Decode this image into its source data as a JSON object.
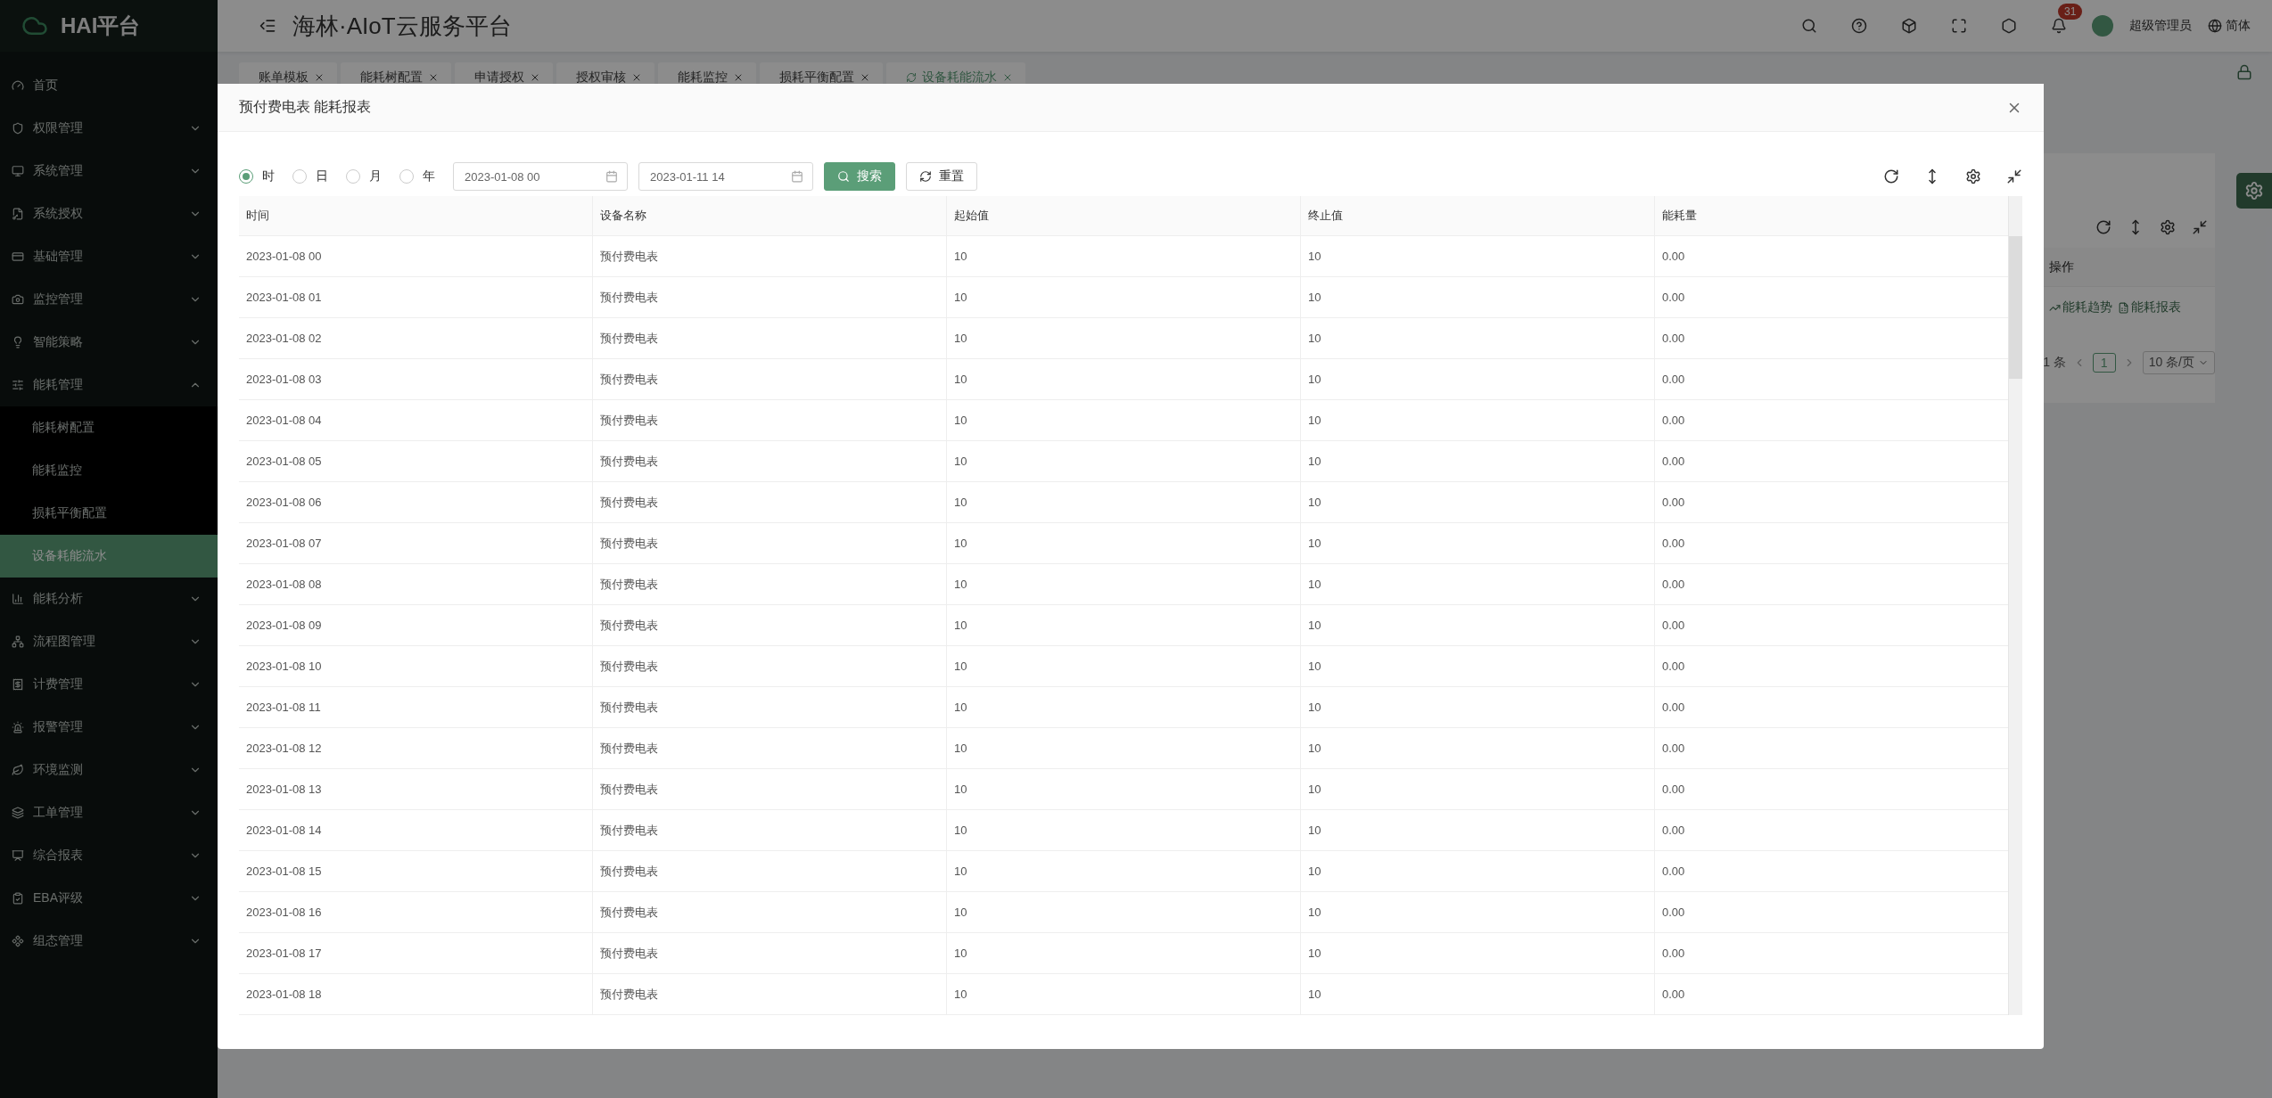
{
  "sidebar": {
    "logo": "HAI平台",
    "items": [
      {
        "label": "首页",
        "kind": "link"
      },
      {
        "label": "权限管理",
        "kind": "group",
        "expanded": false
      },
      {
        "label": "系统管理",
        "kind": "group",
        "expanded": false
      },
      {
        "label": "系统授权",
        "kind": "group",
        "expanded": false
      },
      {
        "label": "基础管理",
        "kind": "group",
        "expanded": false
      },
      {
        "label": "监控管理",
        "kind": "group",
        "expanded": false
      },
      {
        "label": "智能策略",
        "kind": "group",
        "expanded": false
      },
      {
        "label": "能耗管理",
        "kind": "group",
        "expanded": true,
        "children": [
          {
            "label": "能耗树配置",
            "selected": false
          },
          {
            "label": "能耗监控",
            "selected": false
          },
          {
            "label": "损耗平衡配置",
            "selected": false
          },
          {
            "label": "设备耗能流水",
            "selected": true
          }
        ]
      },
      {
        "label": "能耗分析",
        "kind": "group",
        "expanded": false
      },
      {
        "label": "流程图管理",
        "kind": "group",
        "expanded": false
      },
      {
        "label": "计费管理",
        "kind": "group",
        "expanded": false
      },
      {
        "label": "报警管理",
        "kind": "group",
        "expanded": false
      },
      {
        "label": "环境监测",
        "kind": "group",
        "expanded": false
      },
      {
        "label": "工单管理",
        "kind": "group",
        "expanded": false
      },
      {
        "label": "综合报表",
        "kind": "group",
        "expanded": false
      },
      {
        "label": "EBA评级",
        "kind": "group",
        "expanded": false
      },
      {
        "label": "组态管理",
        "kind": "group",
        "expanded": false
      }
    ]
  },
  "header": {
    "title": "海林·AIoT云服务平台",
    "notification_count": "31",
    "user": "超级管理员",
    "language": "简体"
  },
  "tabs": [
    {
      "label": "账单模板",
      "selected": false
    },
    {
      "label": "能耗树配置",
      "selected": false
    },
    {
      "label": "申请授权",
      "selected": false
    },
    {
      "label": "授权审核",
      "selected": false
    },
    {
      "label": "能耗监控",
      "selected": false
    },
    {
      "label": "损耗平衡配置",
      "selected": false
    },
    {
      "label": "设备耗能流水",
      "selected": true
    }
  ],
  "background_panel": {
    "column": "操作",
    "links": [
      "能耗趋势",
      "能耗报表"
    ],
    "total": "1 条",
    "page": "1",
    "page_size": "10 条/页"
  },
  "modal": {
    "title": "预付费电表 能耗报表",
    "granularity": [
      {
        "label": "时",
        "selected": true
      },
      {
        "label": "日",
        "selected": false
      },
      {
        "label": "月",
        "selected": false
      },
      {
        "label": "年",
        "selected": false
      }
    ],
    "date_from": "2023-01-08 00",
    "date_to": "2023-01-11 14",
    "search_button": "搜索",
    "reset_button": "重置",
    "table": {
      "columns": [
        "时间",
        "设备名称",
        "起始值",
        "终止值",
        "能耗量"
      ],
      "rows": [
        [
          "2023-01-08 00",
          "预付费电表",
          "10",
          "10",
          "0.00"
        ],
        [
          "2023-01-08 01",
          "预付费电表",
          "10",
          "10",
          "0.00"
        ],
        [
          "2023-01-08 02",
          "预付费电表",
          "10",
          "10",
          "0.00"
        ],
        [
          "2023-01-08 03",
          "预付费电表",
          "10",
          "10",
          "0.00"
        ],
        [
          "2023-01-08 04",
          "预付费电表",
          "10",
          "10",
          "0.00"
        ],
        [
          "2023-01-08 05",
          "预付费电表",
          "10",
          "10",
          "0.00"
        ],
        [
          "2023-01-08 06",
          "预付费电表",
          "10",
          "10",
          "0.00"
        ],
        [
          "2023-01-08 07",
          "预付费电表",
          "10",
          "10",
          "0.00"
        ],
        [
          "2023-01-08 08",
          "预付费电表",
          "10",
          "10",
          "0.00"
        ],
        [
          "2023-01-08 09",
          "预付费电表",
          "10",
          "10",
          "0.00"
        ],
        [
          "2023-01-08 10",
          "预付费电表",
          "10",
          "10",
          "0.00"
        ],
        [
          "2023-01-08 11",
          "预付费电表",
          "10",
          "10",
          "0.00"
        ],
        [
          "2023-01-08 12",
          "预付费电表",
          "10",
          "10",
          "0.00"
        ],
        [
          "2023-01-08 13",
          "预付费电表",
          "10",
          "10",
          "0.00"
        ],
        [
          "2023-01-08 14",
          "预付费电表",
          "10",
          "10",
          "0.00"
        ],
        [
          "2023-01-08 15",
          "预付费电表",
          "10",
          "10",
          "0.00"
        ],
        [
          "2023-01-08 16",
          "预付费电表",
          "10",
          "10",
          "0.00"
        ],
        [
          "2023-01-08 17",
          "预付费电表",
          "10",
          "10",
          "0.00"
        ],
        [
          "2023-01-08 18",
          "预付费电表",
          "10",
          "10",
          "0.00"
        ]
      ]
    }
  }
}
